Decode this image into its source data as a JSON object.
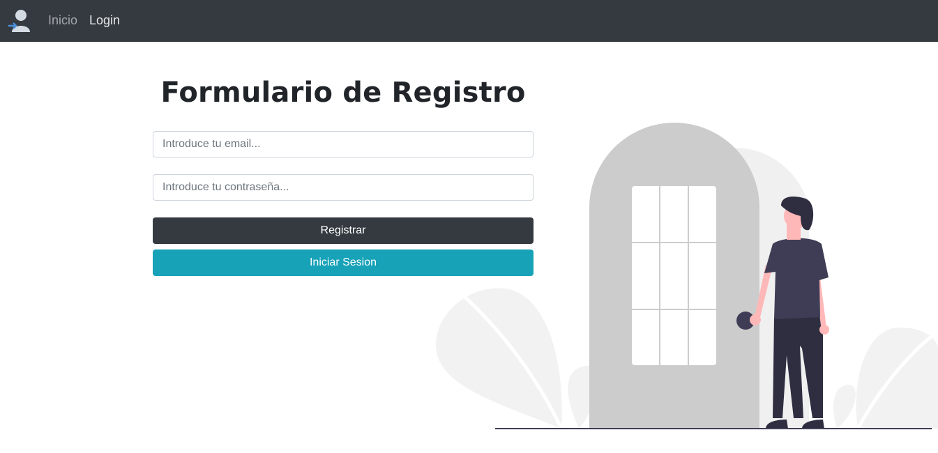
{
  "navbar": {
    "brand_icon": "user-login-icon",
    "links": [
      {
        "label": "Inicio"
      },
      {
        "label": "Login"
      }
    ]
  },
  "form": {
    "title": "Formulario de Registro",
    "email_placeholder": "Introduce tu email...",
    "password_placeholder": "Introduce tu contraseña...",
    "register_label": "Registrar",
    "login_label": "Iniciar Sesion"
  },
  "colors": {
    "navbar_bg": "#343a40",
    "primary_dark": "#343a40",
    "info": "#17a2b8",
    "door": "#cccccc",
    "shirt": "#3f3d56"
  }
}
